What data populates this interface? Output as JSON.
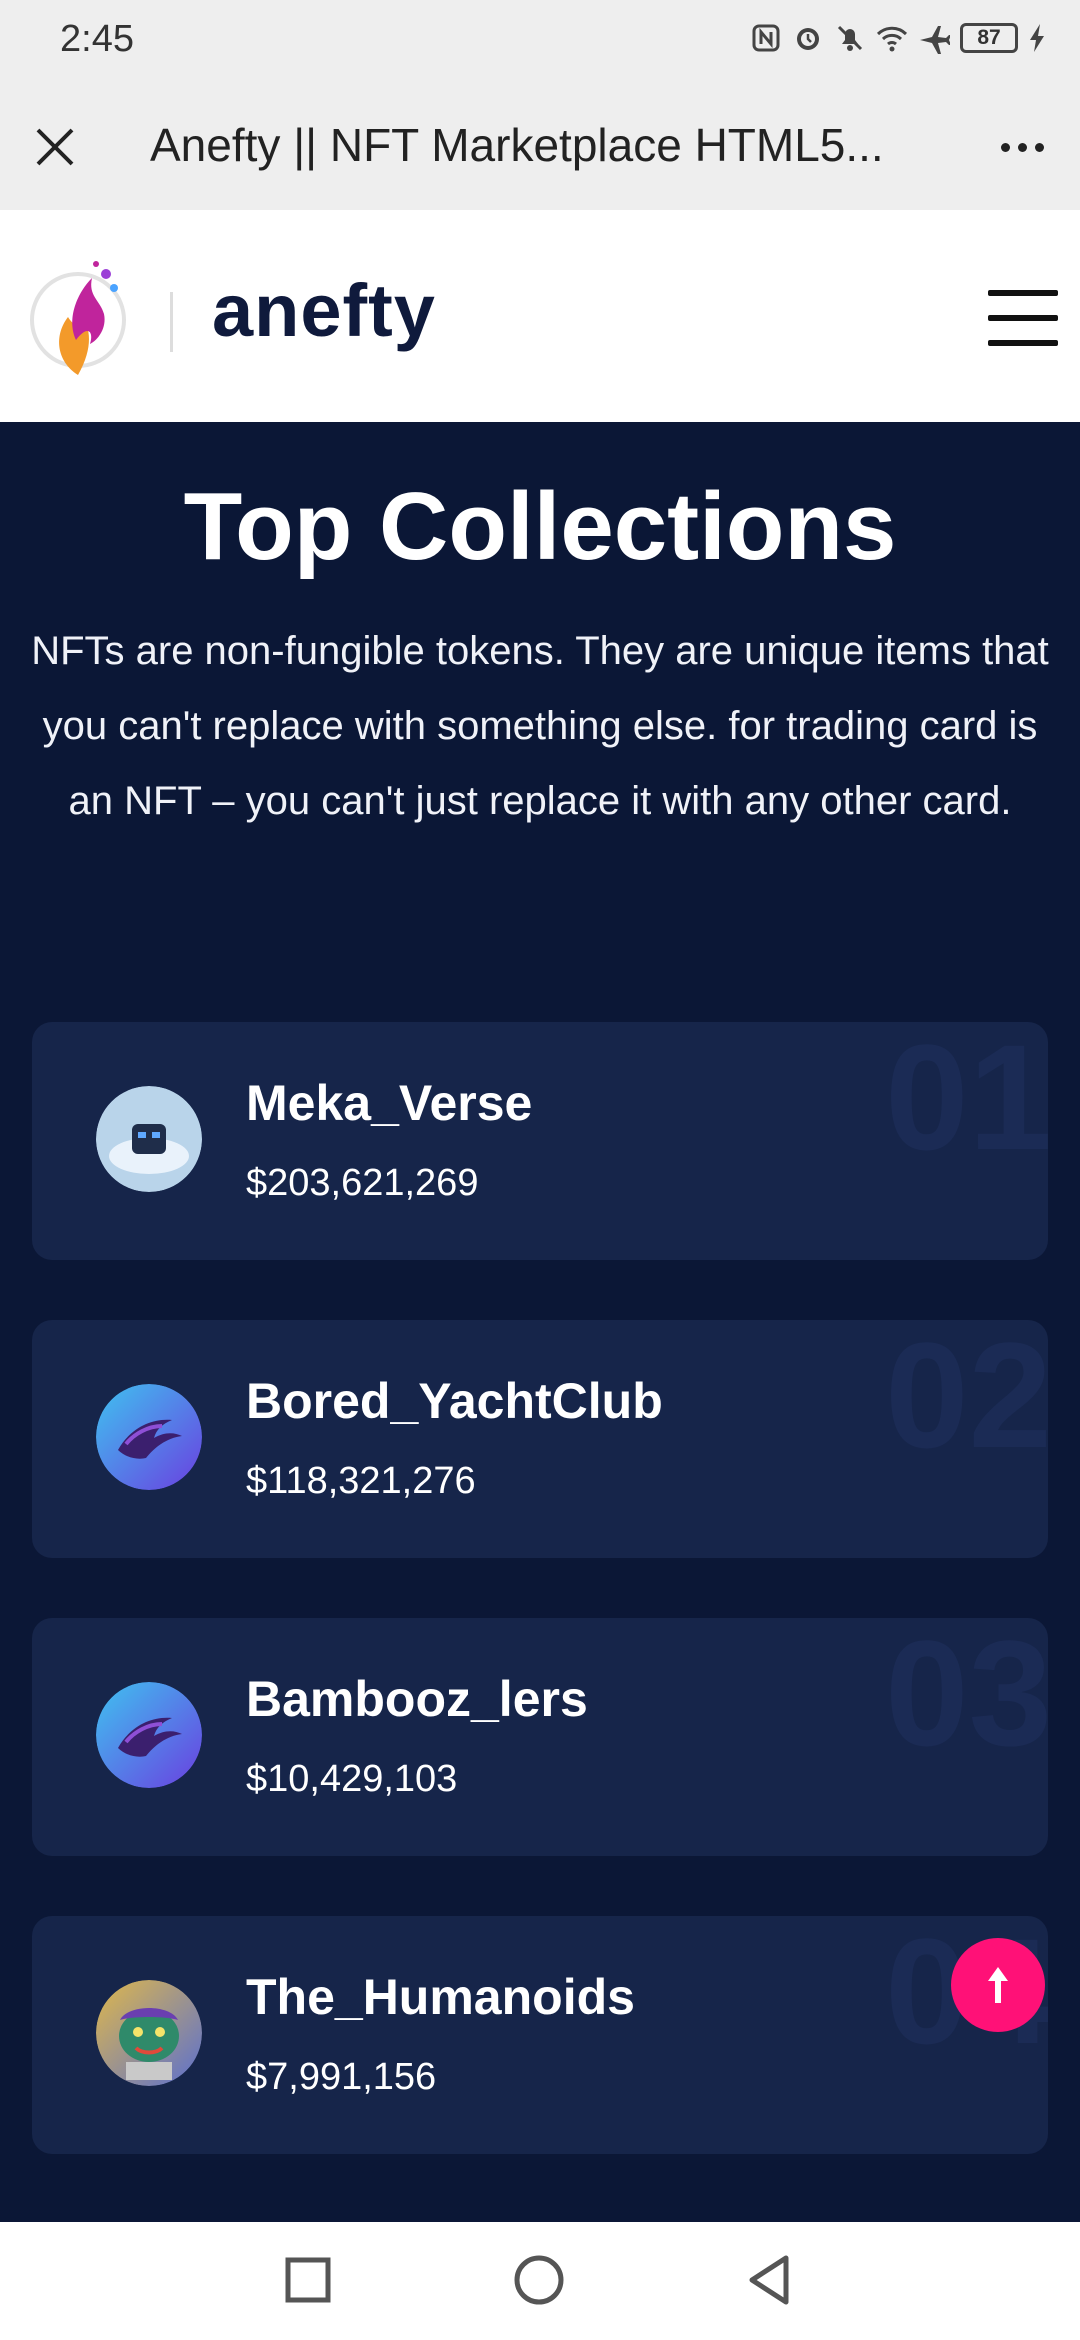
{
  "status_bar": {
    "time": "2:45",
    "battery": "87",
    "icons": [
      "nfc-icon",
      "alarm-icon",
      "mute-icon",
      "wifi-icon",
      "airplane-icon",
      "battery-icon",
      "charging-icon"
    ]
  },
  "browser": {
    "page_title": "Anefty || NFT Marketplace HTML5...",
    "close_icon": "close-icon",
    "more_icon": "more-options-icon"
  },
  "site": {
    "logo_text": "anefty",
    "menu_icon": "hamburger-menu-icon"
  },
  "section": {
    "title": "Top Collections",
    "description": "NFTs are non-fungible tokens. They are unique items that you can't replace with something else. for trading card is an NFT – you can't just replace it with any other card."
  },
  "collections": [
    {
      "rank": "01",
      "name": "Meka_Verse",
      "value": "$203,621,269",
      "avatar_color": "#b9d4ea"
    },
    {
      "rank": "02",
      "name": "Bored_YachtClub",
      "value": "$118,321,276",
      "avatar_color": "#3f7be0"
    },
    {
      "rank": "03",
      "name": "Bambooz_lers",
      "value": "$10,429,103",
      "avatar_color": "#3f7be0"
    },
    {
      "rank": "04",
      "name": "The_Humanoids",
      "value": "$7,991,156",
      "avatar_color": "#d49a3a"
    }
  ],
  "colors": {
    "background": "#0b1736",
    "card": "#16254a",
    "accent": "#ff1177"
  },
  "scroll_top_icon": "arrow-up-icon",
  "nav": {
    "recent_icon": "square-icon",
    "home_icon": "circle-icon",
    "back_icon": "triangle-back-icon"
  }
}
